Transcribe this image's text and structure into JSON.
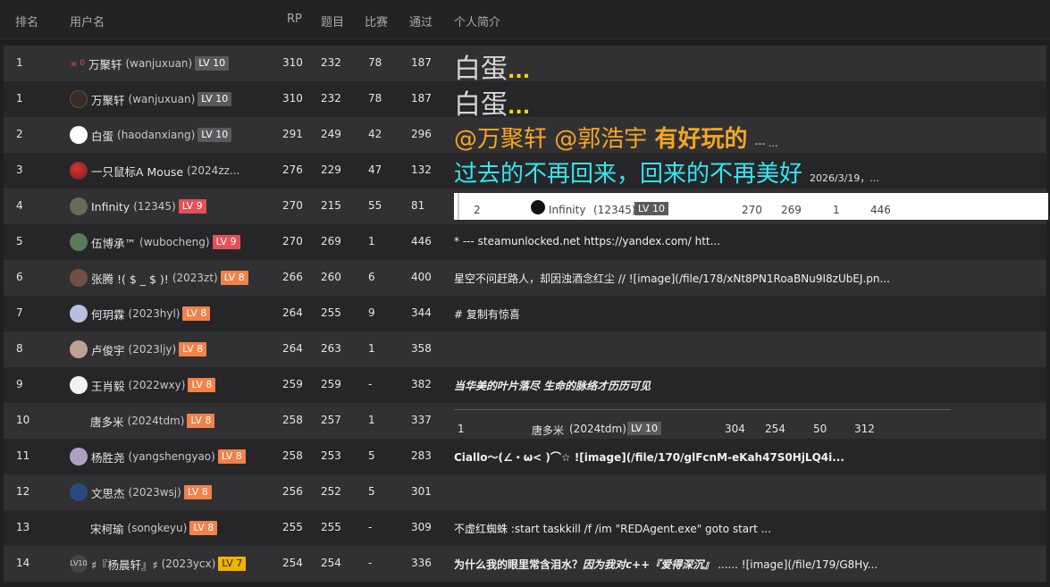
{
  "header": {
    "rank": "排名",
    "user": "用户名",
    "rp": "RP",
    "questions": "题目",
    "matches": "比赛",
    "passed": "通过",
    "intro": "个人简介"
  },
  "rows": [
    {
      "rank": "1",
      "name": "万聚轩",
      "handle": "(wanjuxuan)",
      "lv": "LV 10",
      "rp": "310",
      "q": "232",
      "m": "78",
      "p": "187",
      "intro_a": "白蛋",
      "intro_b": "..."
    },
    {
      "rank": "1",
      "name": "万聚轩",
      "handle": "(wanjuxuan)",
      "lv": "LV 10",
      "rp": "310",
      "q": "232",
      "m": "78",
      "p": "187",
      "intro_a": "白蛋",
      "intro_b": "..."
    },
    {
      "rank": "2",
      "name": "白蛋",
      "handle": "(haodanxiang)",
      "lv": "LV 10",
      "rp": "291",
      "q": "249",
      "m": "42",
      "p": "296",
      "intro_a": "@万聚轩 @郭浩宇 ",
      "intro_b": "有好玩的",
      "intro_c": "--- ..."
    },
    {
      "rank": "3",
      "name": "一只鼠标A Mouse",
      "handle": "(2024zz...",
      "lv": "",
      "rp": "276",
      "q": "229",
      "m": "47",
      "p": "132",
      "intro_a": "过去的不再回来，回来的不再美好",
      "intro_b": "2026/3/19，..."
    },
    {
      "rank": "4",
      "name": "Infinity",
      "handle": "(12345)",
      "lv": "LV 9",
      "rp": "270",
      "q": "215",
      "m": "55",
      "p": "81",
      "intro_a": ""
    },
    {
      "rank": "5",
      "name": "伍博承™",
      "handle": "(wubocheng)",
      "lv": "LV 9",
      "rp": "270",
      "q": "269",
      "m": "1",
      "p": "446",
      "intro_a": "* --- steamunlocked.net https://yandex.com/ htt..."
    },
    {
      "rank": "6",
      "name": "张腾 !( $ _ $ )!",
      "handle": "(2023zt)",
      "lv": "LV 8",
      "rp": "266",
      "q": "260",
      "m": "6",
      "p": "400",
      "intro_a": "星空不问赶路人，却因浊酒念红尘 // ![image](/file/178/xNt8PN1RoaBNu9I8zUbEJ.pn..."
    },
    {
      "rank": "7",
      "name": "何玥霖",
      "handle": "(2023hyl)",
      "lv": "LV 8",
      "rp": "264",
      "q": "255",
      "m": "9",
      "p": "344",
      "intro_a": "# 复制有惊喜"
    },
    {
      "rank": "8",
      "name": "卢俊宇",
      "handle": "(2023ljy)",
      "lv": "LV 8",
      "rp": "264",
      "q": "263",
      "m": "1",
      "p": "358",
      "intro_a": ""
    },
    {
      "rank": "9",
      "name": "王肖毅",
      "handle": "(2022wxy)",
      "lv": "LV 8",
      "rp": "259",
      "q": "259",
      "m": "-",
      "p": "382",
      "intro_a": "当华美的叶片落尽 生命的脉络才历历可见"
    },
    {
      "rank": "10",
      "name": "唐多米",
      "handle": "(2024tdm)",
      "lv": "LV 8",
      "rp": "258",
      "q": "257",
      "m": "1",
      "p": "337",
      "intro_a": ""
    },
    {
      "rank": "11",
      "name": "杨胜尧",
      "handle": "(yangshengyao)",
      "lv": "LV 8",
      "rp": "258",
      "q": "253",
      "m": "5",
      "p": "283",
      "intro_a": "Ciallo～(∠・ω< )⌒☆ ![image](/file/170/glFcnM-eKah47S0HjLQ4i..."
    },
    {
      "rank": "12",
      "name": "文思杰",
      "handle": "(2023wsj)",
      "lv": "LV 8",
      "rp": "256",
      "q": "252",
      "m": "5",
      "p": "301",
      "intro_a": ""
    },
    {
      "rank": "13",
      "name": "宋柯瑜",
      "handle": "(songkeyu)",
      "lv": "LV 8",
      "rp": "255",
      "q": "255",
      "m": "-",
      "p": "309",
      "intro_a": "不虚红蜘蛛 :start taskkill /f /im \"REDAgent.exe\" goto start ..."
    },
    {
      "rank": "14",
      "name": "♯『杨晨轩』♯",
      "handle": "(2023ycx)",
      "lv": "LV 7",
      "rp": "254",
      "q": "254",
      "m": "-",
      "p": "336",
      "intro_a": "为什么我的眼里常含泪水？",
      "intro_b": "因为我对c++『爱得深沉』",
      "intro_c": "...... ![image](/file/179/G8Hy..."
    }
  ],
  "embed1": {
    "rank": "2",
    "name": "Infinity",
    "handle": "(12345)",
    "lv": "LV 10",
    "rp": "270",
    "q": "269",
    "m": "1",
    "p": "446"
  },
  "embed2": {
    "rank": "1",
    "name": "唐多米",
    "handle": "(2024tdm)",
    "lv": "LV 10",
    "rp": "304",
    "q": "254",
    "m": "50",
    "p": "312"
  },
  "row0_mark": {
    "x": "×",
    "zero": "0"
  },
  "row13_prefix": "LV10",
  "colors": {
    "lv_gray": "#5a5a5e",
    "lv_red": "#e05258",
    "lv_orange": "#f0824a",
    "lv_yellow": "#f0b400",
    "accent_orange": "#f5a623",
    "accent_cyan": "#35e6f0",
    "accent_yellow": "#ffd800"
  }
}
